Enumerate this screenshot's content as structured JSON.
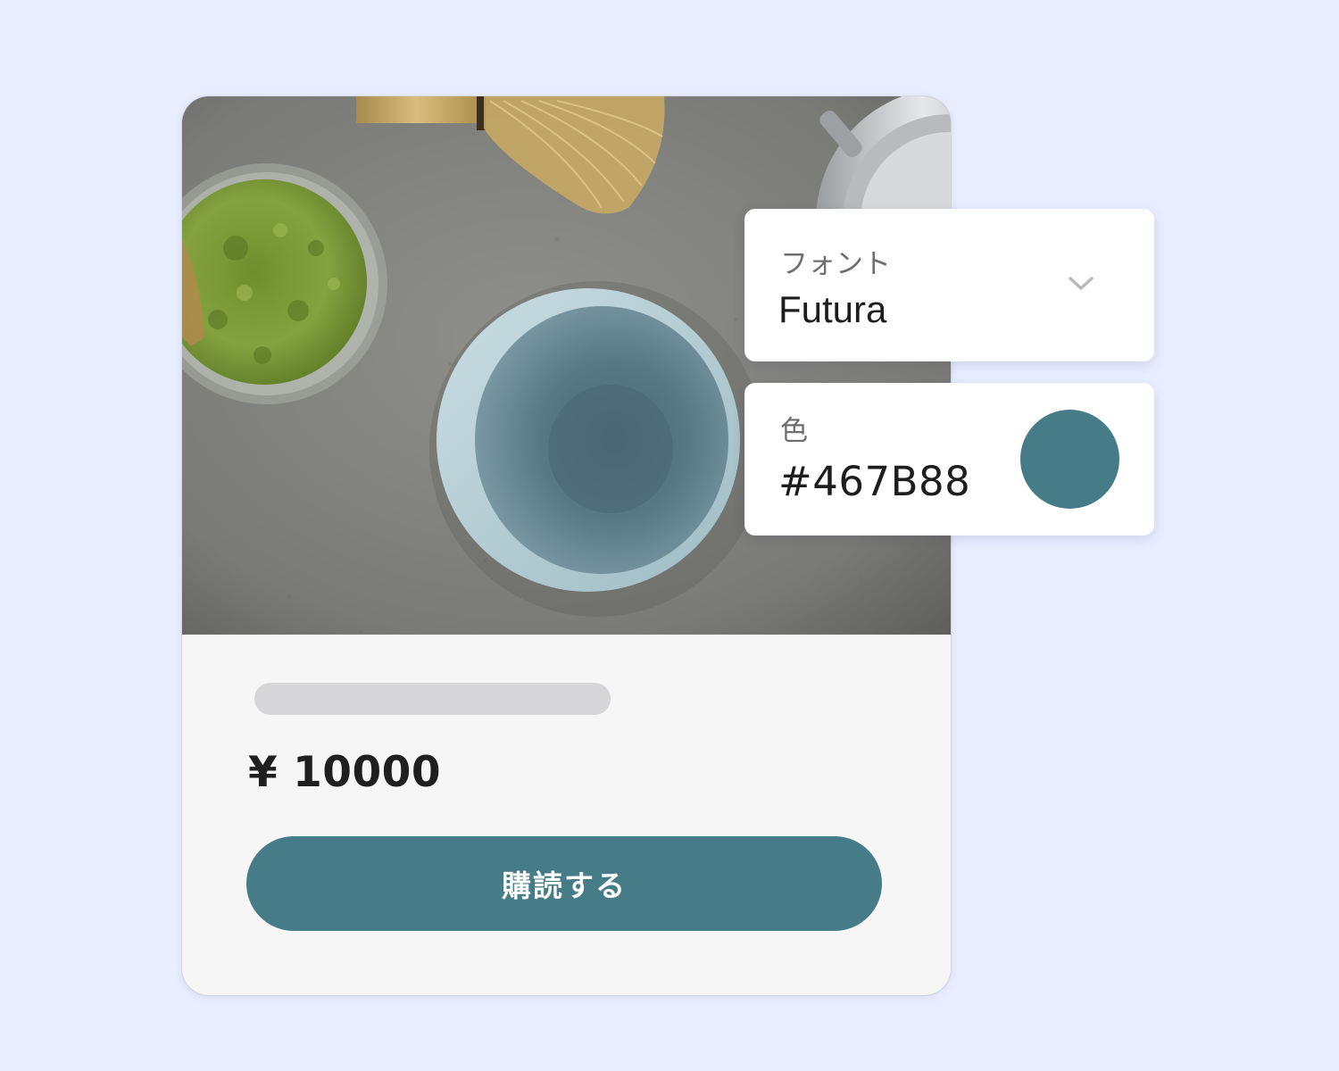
{
  "product": {
    "price": "¥ 10000",
    "buy_label": "購読する",
    "accent_color": "#467B88"
  },
  "settings": {
    "font": {
      "label": "フォント",
      "value": "Futura",
      "icon": "chevron-down-icon"
    },
    "color": {
      "label": "色",
      "value": "#467B88",
      "swatch_color": "#467B88"
    }
  },
  "page": {
    "background_color": "#E9EEFF",
    "card_background": "#F6F6F6"
  }
}
